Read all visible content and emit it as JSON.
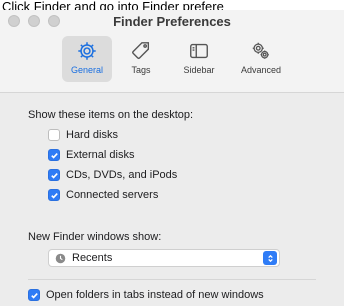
{
  "caption": "Click Finder and go into Finder prefere",
  "window": {
    "title": "Finder Preferences"
  },
  "tabs": [
    {
      "label": "General",
      "icon": "gear-icon",
      "active": true
    },
    {
      "label": "Tags",
      "icon": "tag-icon",
      "active": false
    },
    {
      "label": "Sidebar",
      "icon": "sidebar-icon",
      "active": false
    },
    {
      "label": "Advanced",
      "icon": "gears-icon",
      "active": false
    }
  ],
  "desktop_section": {
    "label": "Show these items on the desktop:",
    "items": [
      {
        "label": "Hard disks",
        "checked": false
      },
      {
        "label": "External disks",
        "checked": true
      },
      {
        "label": "CDs, DVDs, and iPods",
        "checked": true
      },
      {
        "label": "Connected servers",
        "checked": true
      }
    ]
  },
  "new_windows": {
    "label": "New Finder windows show:",
    "selected": "Recents"
  },
  "tabs_option": {
    "label": "Open folders in tabs instead of new windows",
    "checked": true
  },
  "colors": {
    "accent": "#2f7cf6",
    "active_tab_label": "#1a6fe0"
  }
}
